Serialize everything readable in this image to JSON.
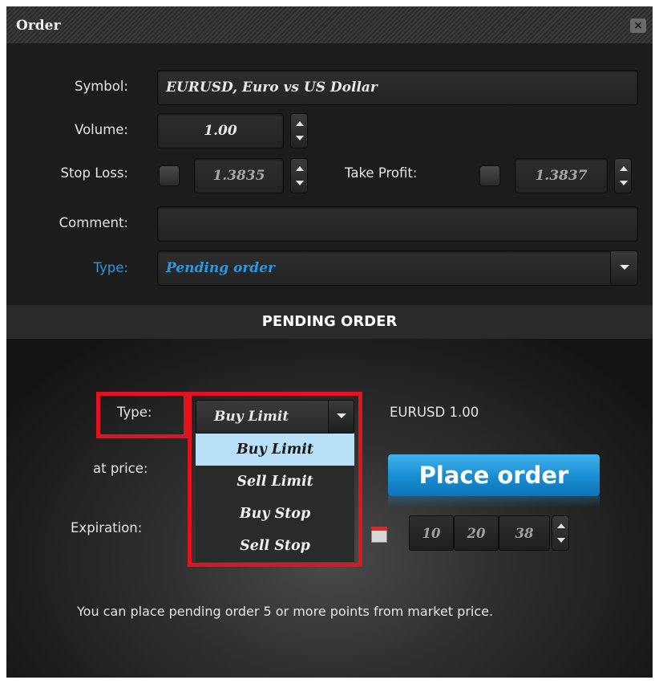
{
  "window": {
    "title": "Order",
    "close_label": "×"
  },
  "form": {
    "symbol_label": "Symbol:",
    "symbol_value": "EURUSD, Euro vs US Dollar",
    "volume_label": "Volume:",
    "volume_value": "1.00",
    "stop_loss_label": "Stop Loss:",
    "stop_loss_value": "1.3835",
    "take_profit_label": "Take Profit:",
    "take_profit_value": "1.3837",
    "comment_label": "Comment:",
    "comment_value": "",
    "type_label": "Type:",
    "type_value": "Pending order"
  },
  "pending": {
    "header": "PENDING ORDER",
    "type_label": "Type:",
    "type_selected": "Buy Limit",
    "type_options": [
      "Buy Limit",
      "Sell Limit",
      "Buy Stop",
      "Sell Stop"
    ],
    "summary": "EURUSD 1.00",
    "at_price_label": "at price:",
    "place_order_label": "Place order",
    "expiration_label": "Expiration:",
    "exp_hour": "10",
    "exp_min": "20",
    "exp_sec": "38",
    "note": "You can place pending order 5 or more points from market price."
  },
  "colors": {
    "accent_blue": "#2b98e0",
    "button_blue": "#1a8fd4",
    "highlight_red": "#e0141e",
    "menu_selected": "#b8e0f8"
  },
  "icons": {
    "close": "close-icon",
    "calendar": "calendar-icon",
    "spinner": "spinner-icon",
    "dropdown": "chevron-down-icon"
  }
}
